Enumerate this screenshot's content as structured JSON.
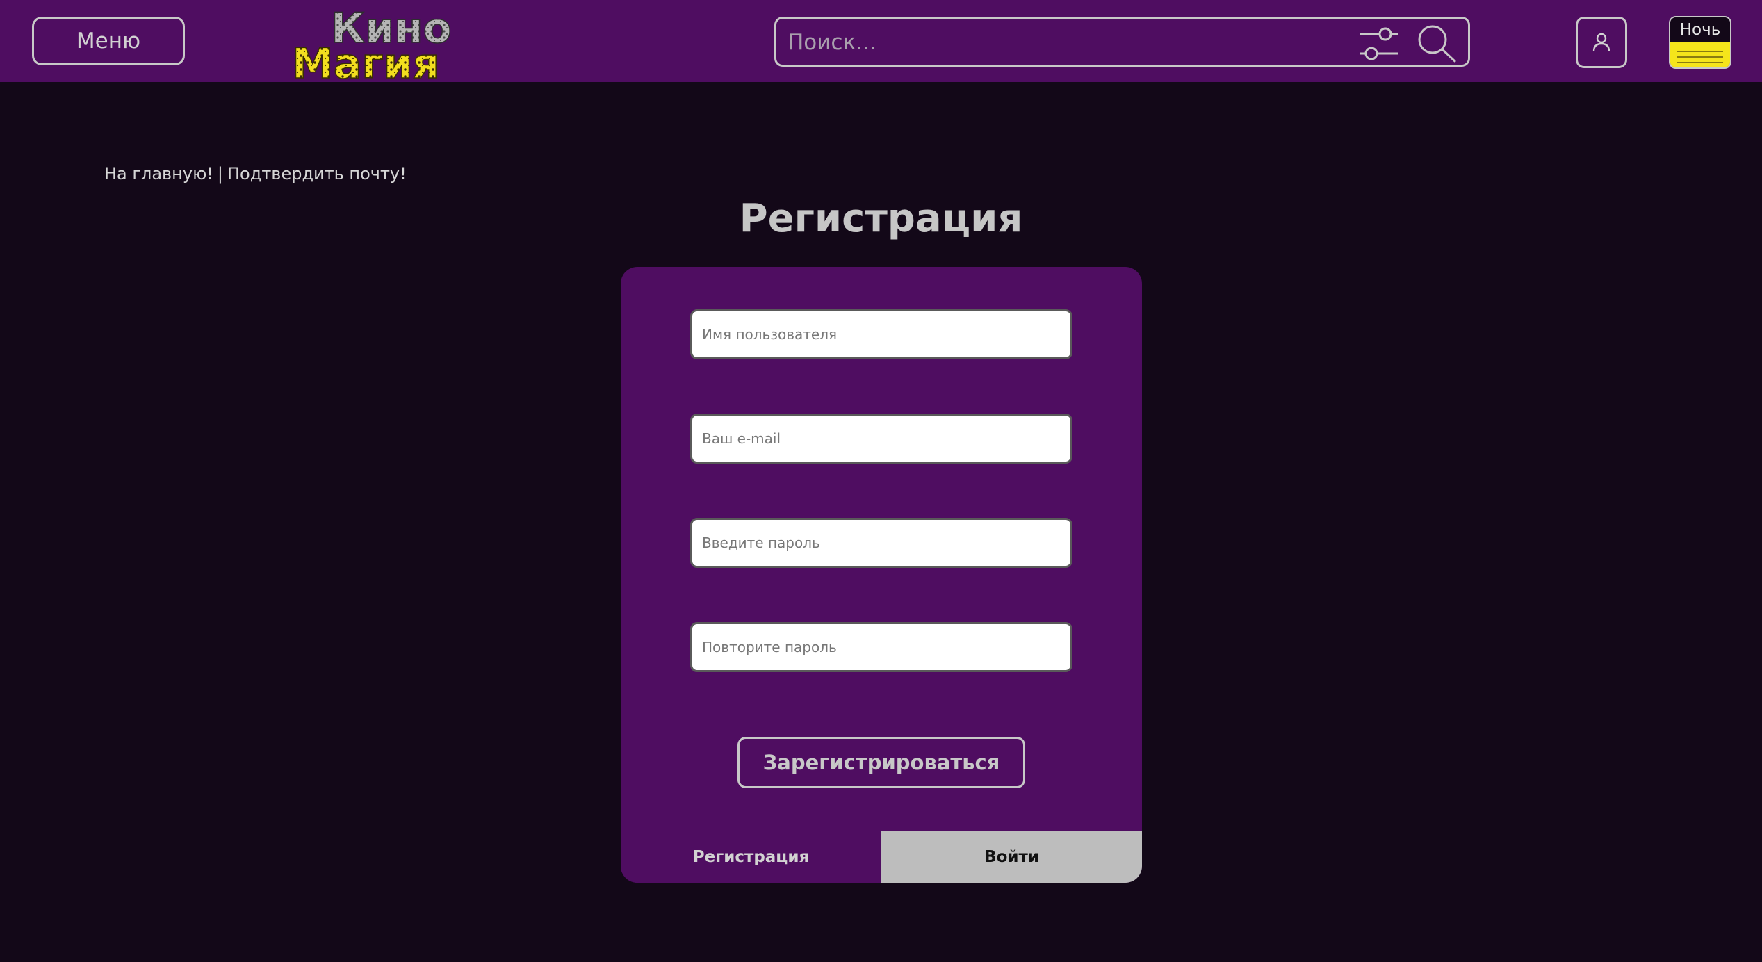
{
  "header": {
    "menu_label": "Меню",
    "logo": {
      "line1": "Кино",
      "line2": "Магия"
    },
    "search_placeholder": "Поиск...",
    "theme_label": "Ночь",
    "colors": {
      "header_bg": "#4f0d61",
      "page_bg": "#130818",
      "theme_accent": "#f5e51b"
    }
  },
  "breadcrumb": {
    "home": "На главную!",
    "separator": "|",
    "confirm": "Подтвердить почту!"
  },
  "page_title": "Регистрация",
  "form": {
    "username_placeholder": "Имя пользователя",
    "email_placeholder": "Ваш e-mail",
    "password_placeholder": "Введите пароль",
    "password_repeat_placeholder": "Повторите пароль",
    "submit_label": "Зарегистрироваться"
  },
  "tabs": {
    "register": "Регистрация",
    "login": "Войти"
  },
  "icons": [
    "filter-icon",
    "search-icon",
    "user-icon"
  ]
}
